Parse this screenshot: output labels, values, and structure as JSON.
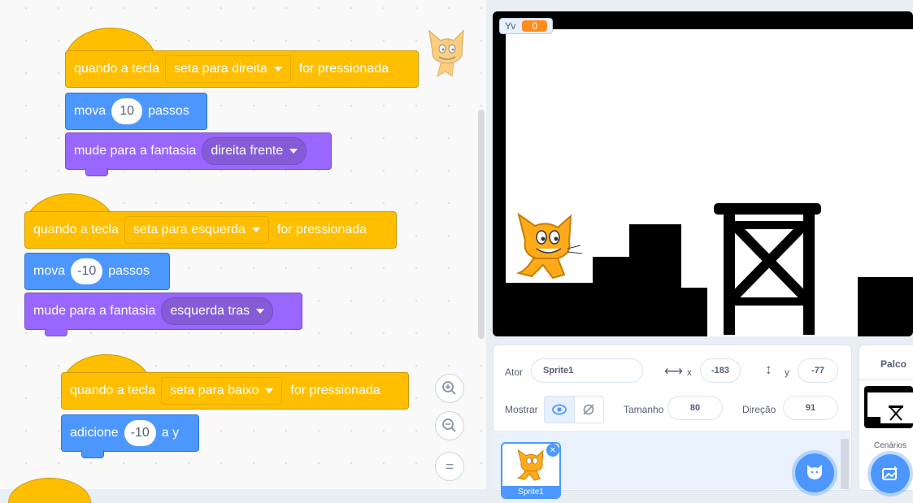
{
  "code_area": {
    "scripts": [
      {
        "hat": {
          "prefix": "quando a tecla",
          "key": "seta para direita",
          "suffix": "for pressionada"
        },
        "motion": {
          "label": "mova",
          "value": "10",
          "suffix": "passos"
        },
        "looks": {
          "label": "mude para a fantasia",
          "value": "direita frente"
        }
      },
      {
        "hat": {
          "prefix": "quando a tecla",
          "key": "seta para esquerda",
          "suffix": "for pressionada"
        },
        "motion": {
          "label": "mova",
          "value": "-10",
          "suffix": "passos"
        },
        "looks": {
          "label": "mude para a fantasia",
          "value": "esquerda tras"
        }
      },
      {
        "hat": {
          "prefix": "quando a tecla",
          "key": "seta para baixo",
          "suffix": "for pressionada"
        },
        "change": {
          "label": "adicione",
          "value": "-10",
          "suffix": "a y"
        }
      }
    ],
    "zoom": {
      "zoom_in": "+",
      "zoom_out": "−",
      "reset": "="
    }
  },
  "stage": {
    "monitor": {
      "name": "Yv",
      "value": "0"
    }
  },
  "sprite_info": {
    "sprite_label": "Ator",
    "sprite_name": "Sprite1",
    "x_label": "x",
    "x_value": "-183",
    "y_label": "y",
    "y_value": "-77",
    "show_label": "Mostrar",
    "size_label": "Tamanho",
    "size_value": "80",
    "direction_label": "Direção",
    "direction_value": "91"
  },
  "sprite_list": {
    "items": [
      {
        "name": "Sprite1"
      }
    ]
  },
  "stage_panel": {
    "title": "Palco",
    "backdrops_label": "Cenários"
  },
  "colors": {
    "events": "#ffbf00",
    "motion": "#4c97ff",
    "looks": "#9966ff",
    "accent": "#4c97ff",
    "monitor": "#ff8c1a"
  }
}
